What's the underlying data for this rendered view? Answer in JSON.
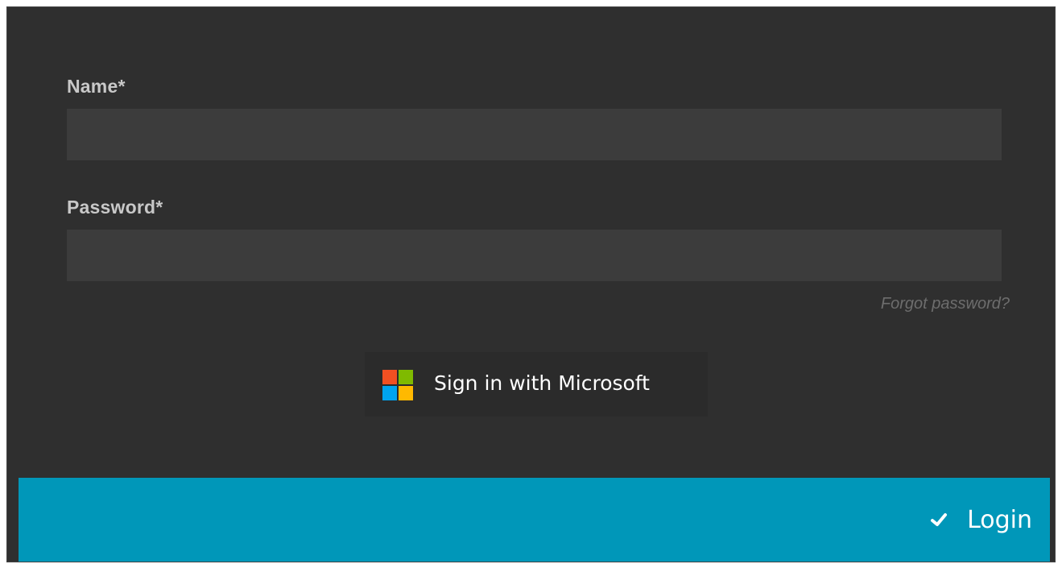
{
  "form": {
    "name_label": "Name*",
    "name_value": "",
    "password_label": "Password*",
    "password_value": "",
    "forgot_link": "Forgot password?"
  },
  "microsoft_signin": {
    "label": "Sign in with Microsoft",
    "icon": "microsoft-logo-icon",
    "logo_colors": [
      "#f25022",
      "#7fba00",
      "#00a4ef",
      "#ffb900"
    ]
  },
  "footer": {
    "login_label": "Login",
    "login_icon": "checkmark-icon",
    "accent_color": "#0097b9"
  }
}
